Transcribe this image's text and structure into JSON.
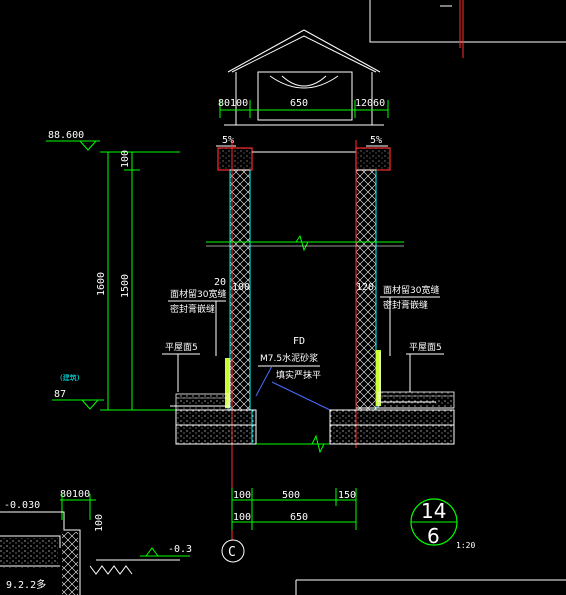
{
  "colors": {
    "background": "#000000",
    "line": "#ffffff",
    "dimension": "#00ff00",
    "axis": "#ff3030",
    "outline": "#00ffff",
    "cap": "#ff2a2a",
    "insulation": "#ccff33",
    "leader": "#4a6bff"
  },
  "labels": {
    "elev_top": "88.600",
    "elev_base": "87",
    "elev_tag": "(建筑)",
    "elev_lower_a": "-0.030",
    "elev_lower_b": "-0.3",
    "dim_top_left": "80100",
    "dim_top_mid": "650",
    "dim_top_right": "12060",
    "slope_left": "5%",
    "slope_right": "5%",
    "dim_v_100": "100",
    "dim_v_1600": "1600",
    "dim_v_1500": "1500",
    "dim_20": "20",
    "dim_100_left": "100",
    "dim_120": "120",
    "note_face_left": "面材留30宽缝",
    "note_seal_left": "密封膏嵌缝",
    "note_face_right": "面材留30宽缝",
    "note_seal_right": "密封膏嵌缝",
    "roof_left": "平屋面5",
    "roof_right": "平屋面5",
    "note_fd": "FD",
    "note_mortar": "M7.5水泥砂浆",
    "note_fill": "填实严抹平",
    "dim_b_100a": "100",
    "dim_b_500": "500",
    "dim_b_150": "150",
    "dim_b_100b": "100",
    "dim_b_650": "650",
    "axis_tag": "C",
    "detail_num": "14",
    "detail_sheet": "6",
    "scale": "1:20",
    "lower_dim_a": "80100",
    "lower_dim_b": "100",
    "lower_text": "9.2.2多"
  }
}
